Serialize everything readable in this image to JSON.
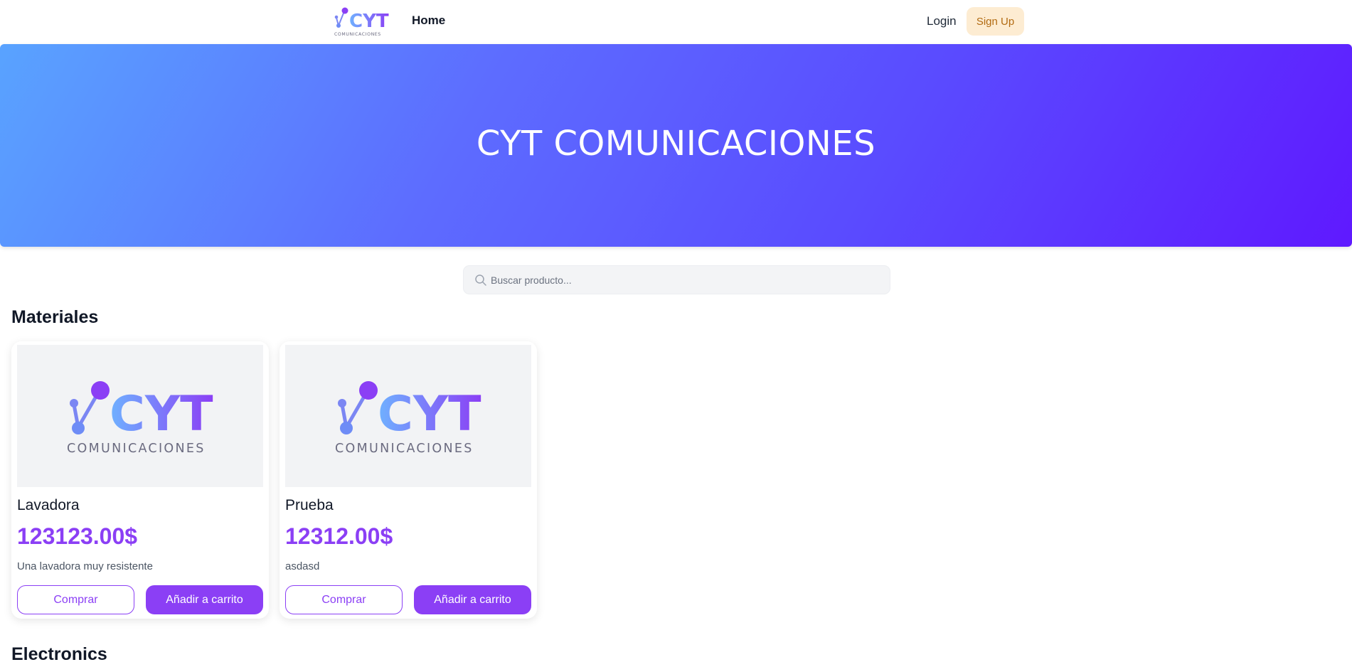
{
  "brand": {
    "name": "CYT",
    "subtitle": "COMUNICACIONES",
    "colors": {
      "gradient_start": "#6fb1ff",
      "gradient_end": "#8b3ff5",
      "accent": "#8b3ff5",
      "hero_start": "#59a3ff",
      "hero_end": "#5f19ff",
      "signup_bg": "#fdecd2",
      "signup_text": "#b26b12"
    }
  },
  "nav": {
    "home": "Home",
    "login": "Login",
    "signup": "Sign Up"
  },
  "hero": {
    "title": "CYT COMUNICACIONES"
  },
  "search": {
    "placeholder": "Buscar producto...",
    "icon": "search-icon"
  },
  "sections": [
    {
      "title": "Materiales",
      "products": [
        {
          "name": "Lavadora",
          "price": "123123.00$",
          "description": "Una lavadora muy resistente",
          "buy_label": "Comprar",
          "cart_label": "Añadir a carrito"
        },
        {
          "name": "Prueba",
          "price": "12312.00$",
          "description": "asdasd",
          "buy_label": "Comprar",
          "cart_label": "Añadir a carrito"
        }
      ]
    },
    {
      "title": "Electronics",
      "products": []
    }
  ]
}
